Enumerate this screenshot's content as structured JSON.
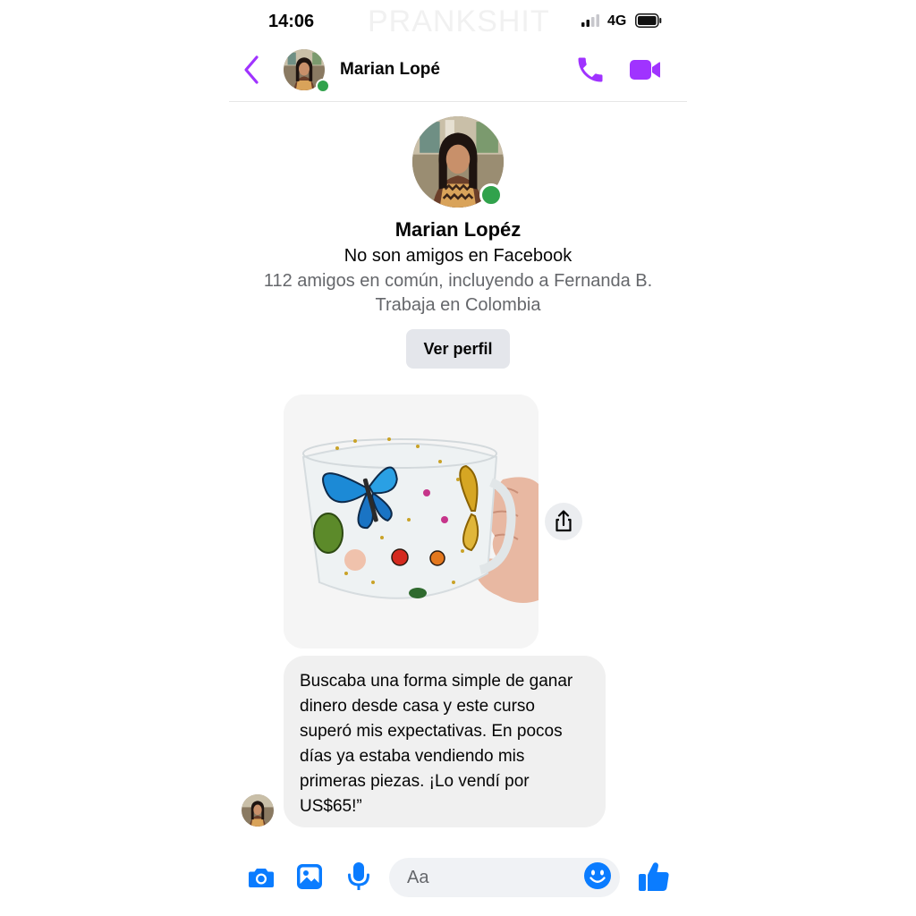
{
  "status_bar": {
    "time": "14:06",
    "network": "4G"
  },
  "watermark": "PRANKSHIT",
  "header": {
    "contact_name": "Marian Lopé"
  },
  "profile": {
    "name": "Marian Lopéz",
    "friend_status": "No son amigos en Facebook",
    "mutual_friends": "112 amigos en común, incluyendo a Fernanda B.",
    "work": "Trabaja en Colombia",
    "view_profile_label": "Ver perfil"
  },
  "message": {
    "text": "Buscaba una forma simple de ganar dinero desde casa y este curso superó mis expectativas. En pocos días ya estaba vendiendo mis primeras piezas. ¡Lo vendí por US$65!”"
  },
  "composer": {
    "placeholder": "Aa"
  },
  "colors": {
    "accent": "#a033ff",
    "messenger_blue": "#0a7cff",
    "online": "#31a24c"
  },
  "icons": [
    "back-arrow-icon",
    "phone-icon",
    "video-icon",
    "share-icon",
    "camera-icon",
    "gallery-icon",
    "microphone-icon",
    "emoji-icon",
    "thumbs-up-icon"
  ]
}
